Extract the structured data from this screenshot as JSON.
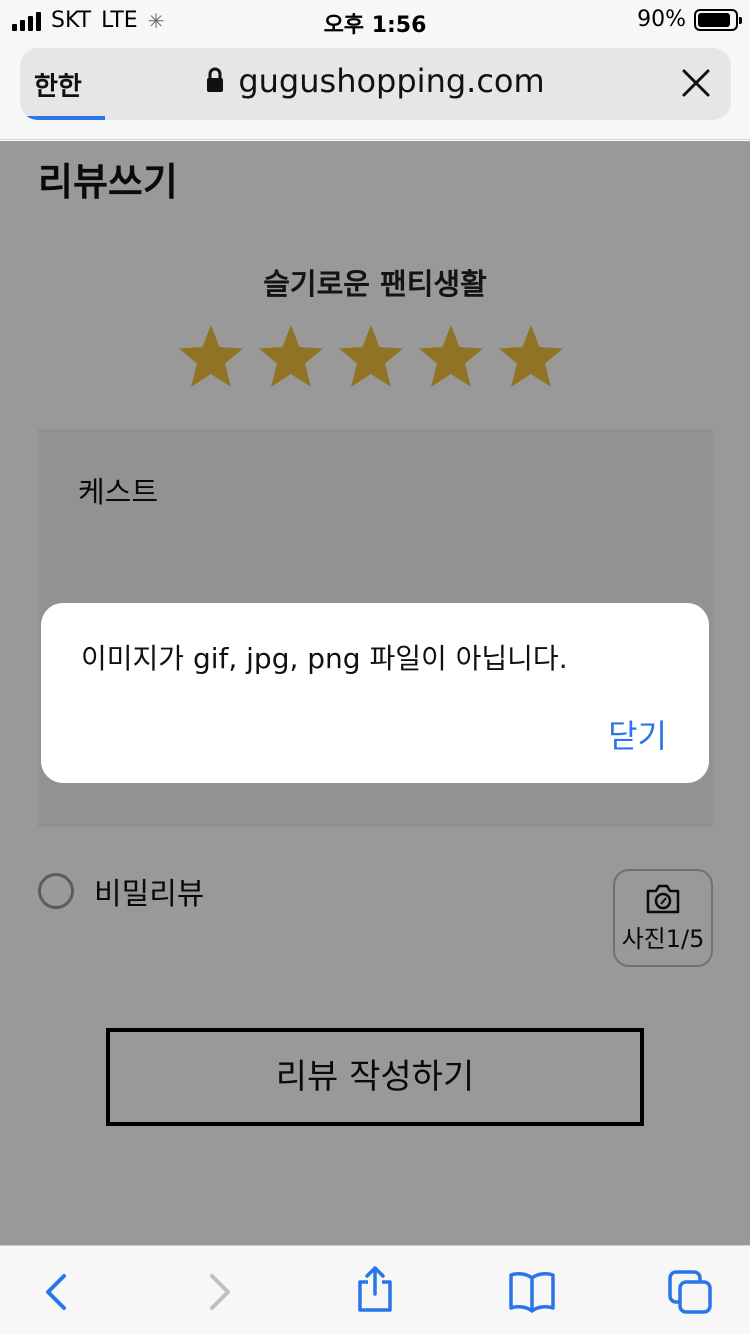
{
  "status_bar": {
    "carrier": "SKT",
    "network": "LTE",
    "time": "오후 1:56",
    "battery": "90%",
    "battery_level": 0.9
  },
  "browser": {
    "reader_button": "한한",
    "url": "gugushopping.com",
    "load_progress": 0.12
  },
  "page": {
    "title": "리뷰쓰기",
    "product_name": "슬기로운 팬티생활",
    "rating": 5,
    "rating_max": 5,
    "star_color": "#f0c13d",
    "review_text": "케스트",
    "secret_review_label": "비밀리뷰",
    "photo_button_label": "사진1/5",
    "submit_label": "리뷰 작성하기"
  },
  "alert": {
    "message": "이미지가 gif, jpg, png 파일이 아닙니다.",
    "close_label": "닫기",
    "accent": "#2a75e8"
  },
  "toolbar": {
    "icons": [
      "back-icon",
      "forward-icon",
      "share-icon",
      "bookmarks-icon",
      "tabs-icon"
    ]
  }
}
